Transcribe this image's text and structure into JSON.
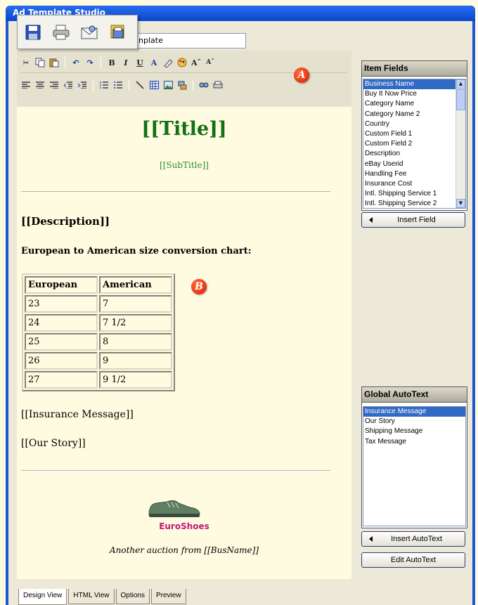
{
  "window": {
    "title": "Ad Template Studio"
  },
  "name_field": {
    "value": "nplate"
  },
  "badges": {
    "a": "A",
    "b": "B"
  },
  "canvas": {
    "title": "[[Title]]",
    "subtitle": "[[SubTitle]]",
    "description": "[[Description]]",
    "chart_caption": "European to American size conversion chart:",
    "table": {
      "headers": [
        "European",
        "American"
      ],
      "rows": [
        [
          "23",
          "7"
        ],
        [
          "24",
          "7 1/2"
        ],
        [
          "25",
          "8"
        ],
        [
          "26",
          "9"
        ],
        [
          "27",
          "9 1/2"
        ]
      ]
    },
    "insurance": "[[Insurance Message]]",
    "story": "[[Our Story]]",
    "brand": "EuroShoes",
    "footer": "Another auction from [[BusName]]"
  },
  "item_fields": {
    "header": "Item Fields",
    "items": [
      "Business Name",
      "Buy It Now Price",
      "Category Name",
      "Category Name 2",
      "Country",
      "Custom Field 1",
      "Custom Field 2",
      "Description",
      "eBay Userid",
      "Handling Fee",
      "Insurance Cost",
      "Intl. Shipping Service 1",
      "Intl. Shipping Service 2"
    ],
    "selected": 0,
    "insert_button": "Insert Field"
  },
  "autotext": {
    "header": "Global AutoText",
    "items": [
      "Insurance Message",
      "Our Story",
      "Shipping Message",
      "Tax Message"
    ],
    "selected": 0,
    "insert_button": "Insert AutoText",
    "edit_button": "Edit AutoText"
  },
  "tabs": [
    "Design View",
    "HTML View",
    "Options",
    "Preview"
  ],
  "active_tab": 0,
  "colors": {
    "title": "#127014",
    "brand": "#c1197a",
    "selection": "#316ac5",
    "badge": "#d91a00"
  }
}
